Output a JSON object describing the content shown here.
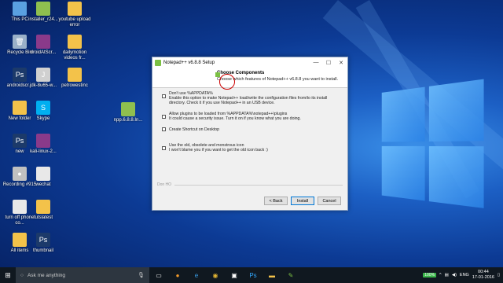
{
  "desktop_icons": [
    {
      "label": "This PC",
      "icon": "pc-icon"
    },
    {
      "label": "installer_r24...",
      "icon": "installer-icon"
    },
    {
      "label": "youtube upload error",
      "icon": "folder-icon"
    },
    {
      "label": "Recycle Bin",
      "icon": "recycle-bin-icon"
    },
    {
      "label": "droidAtScr...",
      "icon": "rar-icon"
    },
    {
      "label": "dailymotion videos fr...",
      "icon": "folder-icon"
    },
    {
      "label": "androidscr...",
      "icon": "photoshop-icon"
    },
    {
      "label": "jdk-8u65-w...",
      "icon": "java-icon"
    },
    {
      "label": "petrowestinc",
      "icon": "folder-icon"
    },
    {
      "label": "New folder",
      "icon": "folder-icon"
    },
    {
      "label": "Skype",
      "icon": "skype-icon"
    },
    {
      "label": "new",
      "icon": "photoshop-icon"
    },
    {
      "label": "kali-linux-2...",
      "icon": "rar-icon"
    },
    {
      "label": "Recording #915",
      "icon": "recording-icon"
    },
    {
      "label": "wechat",
      "icon": "file-icon"
    },
    {
      "label": "turn off phone co...",
      "icon": "file-icon"
    },
    {
      "label": "tutslatest",
      "icon": "folder-icon"
    },
    {
      "label": "All items",
      "icon": "folder-icon"
    },
    {
      "label": "thumbnail",
      "icon": "photoshop-icon"
    },
    {
      "label": "npp.6.8.8.In...",
      "icon": "installer-icon"
    }
  ],
  "dialog": {
    "title": "Notepad++ v6.8.8 Setup",
    "header_title": "Choose Components",
    "header_sub": "Choose which features of Notepad++ v6.8.8 you want to install.",
    "options": [
      {
        "label": "Don't use %APPDATA%",
        "desc": "Enable this option to make Notepad++ load/write the configuration files from/to its install directory. Check it if you use Notepad++ in an USB device.",
        "checked": false
      },
      {
        "label": "Allow plugins to be loaded from %APPDATA%\\notepad++\\plugins",
        "desc": "It could cause a security issue. Turn it on if you know what you are doing.",
        "checked": false
      },
      {
        "label": "Create Shortcut on Desktop",
        "desc": "",
        "checked": false
      },
      {
        "label": "Use the old, obsolete and monstrous icon",
        "desc": "I won't blame you if you want to get the old icon back :)",
        "checked": false
      }
    ],
    "brand": "Don HO",
    "back_label": "< Back",
    "install_label": "Install",
    "cancel_label": "Cancel",
    "minimize": "—",
    "maximize": "☐",
    "close": "✕"
  },
  "taskbar": {
    "search_placeholder": "Ask me anything",
    "battery": "100%",
    "language": "ENG",
    "time": "00:44",
    "date": "17-01-2016"
  }
}
